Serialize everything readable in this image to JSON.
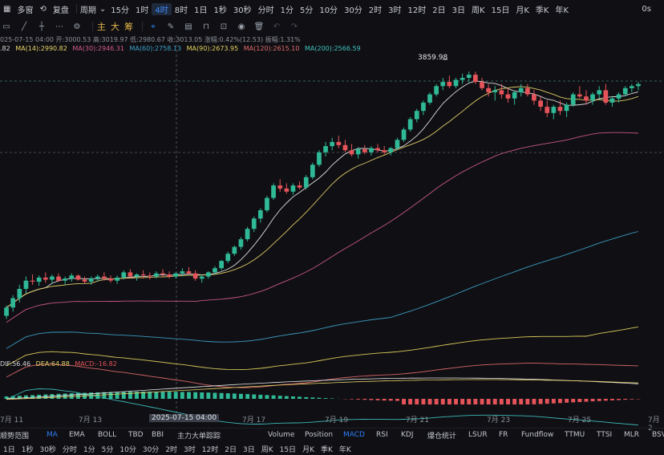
{
  "topbar": {
    "items": [
      "多窗",
      "复盘",
      "周期",
      "15分",
      "1时",
      "4时",
      "8时",
      "1日",
      "1秒",
      "30秒",
      "分时",
      "1分",
      "5分",
      "10分",
      "30分",
      "2时",
      "3时",
      "12时",
      "2日",
      "3日",
      "周K",
      "15日",
      "月K",
      "季K",
      "年K"
    ],
    "active": "4时",
    "right": "0s"
  },
  "toolbar": {
    "cn_buttons": [
      "主",
      "大",
      "筹"
    ]
  },
  "info": {
    "line1": "025-07-15 04:00  开:3000.53  高:3019.97  低:2980.67  收:3013.05  涨幅:0.42%(12.53)  振幅:1.31%",
    "ma": [
      {
        "text": ".82",
        "color": "#d8d8d8"
      },
      {
        "text": "MA(14):2990.82",
        "color": "#e8d36a"
      },
      {
        "text": "MA(30):2946.31",
        "color": "#d05a8a"
      },
      {
        "text": "MA(60):2758.13",
        "color": "#3da0c8"
      },
      {
        "text": "MA(90):2673.95",
        "color": "#e3d25d"
      },
      {
        "text": "MA(120):2615.10",
        "color": "#e06a6a"
      },
      {
        "text": "MA(200):2566.59",
        "color": "#3fc1c0"
      }
    ]
  },
  "macd": {
    "dif": "DIF:56.46",
    "dea": "DEA:64.88",
    "macd": "MACD:-16.82"
  },
  "high_label": "3859.98",
  "xaxis": {
    "labels": [
      "7月 11",
      "7月 13",
      "2025-07-15 04:00",
      "7月 17",
      "7月 19",
      "7月 21",
      "7月 23",
      "7月 25",
      "7月 2"
    ]
  },
  "indicators": {
    "items": [
      "顺势范围",
      "MA",
      "EMA",
      "BOLL",
      "TBD",
      "BBI",
      "主力大单踪踪",
      "Volume",
      "Position",
      "MACD",
      "RSI",
      "KDJ",
      "爆仓统计",
      "LSUR",
      "FR",
      "Fundflow",
      "TTMU",
      "TTSI",
      "MLR",
      "BSV"
    ],
    "active": [
      "MA",
      "MACD"
    ]
  },
  "bottombar": {
    "items": [
      "1日",
      "1秒",
      "30秒",
      "分时",
      "1分",
      "5分",
      "10分",
      "30分",
      "2时",
      "3时",
      "12时",
      "2日",
      "3日",
      "周K",
      "15日",
      "月K",
      "季K",
      "年K"
    ]
  },
  "colors": {
    "up": "#2fb996",
    "down": "#e5545a",
    "bg": "#101014"
  },
  "chart_data": {
    "type": "candlestick",
    "note_unit": "ETH price",
    "candles": [
      [
        2680,
        2730,
        2665,
        2720
      ],
      [
        2720,
        2780,
        2700,
        2765
      ],
      [
        2765,
        2830,
        2745,
        2810
      ],
      [
        2810,
        2870,
        2790,
        2850
      ],
      [
        2850,
        2880,
        2830,
        2845
      ],
      [
        2845,
        2875,
        2825,
        2865
      ],
      [
        2865,
        2890,
        2840,
        2855
      ],
      [
        2855,
        2880,
        2835,
        2870
      ],
      [
        2870,
        2885,
        2845,
        2850
      ],
      [
        2850,
        2870,
        2830,
        2860
      ],
      [
        2860,
        2885,
        2845,
        2875
      ],
      [
        2875,
        2880,
        2850,
        2855
      ],
      [
        2855,
        2870,
        2835,
        2845
      ],
      [
        2845,
        2870,
        2830,
        2860
      ],
      [
        2860,
        2880,
        2845,
        2870
      ],
      [
        2870,
        2890,
        2850,
        2860
      ],
      [
        2860,
        2875,
        2840,
        2850
      ],
      [
        2850,
        2875,
        2835,
        2865
      ],
      [
        2865,
        2900,
        2855,
        2890
      ],
      [
        2890,
        2905,
        2860,
        2870
      ],
      [
        2870,
        2885,
        2850,
        2880
      ],
      [
        2880,
        2900,
        2860,
        2875
      ],
      [
        2875,
        2890,
        2855,
        2870
      ],
      [
        2870,
        2895,
        2860,
        2885
      ],
      [
        2885,
        2905,
        2870,
        2880
      ],
      [
        2880,
        2895,
        2860,
        2870
      ],
      [
        2870,
        2890,
        2860,
        2885
      ],
      [
        2885,
        2910,
        2870,
        2895
      ],
      [
        2895,
        2915,
        2880,
        2885
      ],
      [
        2885,
        2900,
        2850,
        2860
      ],
      [
        2860,
        2880,
        2840,
        2870
      ],
      [
        2870,
        2895,
        2860,
        2890
      ],
      [
        2890,
        2920,
        2880,
        2910
      ],
      [
        2910,
        2950,
        2900,
        2945
      ],
      [
        2945,
        2990,
        2935,
        2980
      ],
      [
        2980,
        3020,
        2970,
        3013
      ],
      [
        3013,
        3060,
        3000,
        3050
      ],
      [
        3050,
        3110,
        3040,
        3100
      ],
      [
        3100,
        3160,
        3085,
        3150
      ],
      [
        3150,
        3200,
        3130,
        3190
      ],
      [
        3190,
        3260,
        3180,
        3250
      ],
      [
        3250,
        3320,
        3240,
        3310
      ],
      [
        3310,
        3340,
        3280,
        3295
      ],
      [
        3295,
        3320,
        3270,
        3280
      ],
      [
        3280,
        3320,
        3265,
        3310
      ],
      [
        3310,
        3330,
        3290,
        3300
      ],
      [
        3300,
        3360,
        3290,
        3350
      ],
      [
        3350,
        3420,
        3340,
        3410
      ],
      [
        3410,
        3480,
        3400,
        3470
      ],
      [
        3470,
        3520,
        3450,
        3500
      ],
      [
        3500,
        3540,
        3480,
        3520
      ],
      [
        3520,
        3550,
        3490,
        3505
      ],
      [
        3505,
        3530,
        3470,
        3480
      ],
      [
        3480,
        3510,
        3450,
        3460
      ],
      [
        3460,
        3495,
        3440,
        3485
      ],
      [
        3485,
        3505,
        3460,
        3470
      ],
      [
        3470,
        3500,
        3455,
        3490
      ],
      [
        3490,
        3510,
        3470,
        3480
      ],
      [
        3480,
        3500,
        3460,
        3470
      ],
      [
        3470,
        3495,
        3455,
        3490
      ],
      [
        3490,
        3540,
        3480,
        3530
      ],
      [
        3530,
        3590,
        3520,
        3580
      ],
      [
        3580,
        3640,
        3570,
        3630
      ],
      [
        3630,
        3680,
        3615,
        3670
      ],
      [
        3670,
        3720,
        3650,
        3710
      ],
      [
        3710,
        3760,
        3700,
        3750
      ],
      [
        3750,
        3800,
        3740,
        3790
      ],
      [
        3790,
        3830,
        3770,
        3810
      ],
      [
        3810,
        3840,
        3780,
        3790
      ],
      [
        3790,
        3830,
        3780,
        3820
      ],
      [
        3820,
        3850,
        3800,
        3830
      ],
      [
        3830,
        3860,
        3810,
        3845
      ],
      [
        3845,
        3859.98,
        3800,
        3810
      ],
      [
        3810,
        3830,
        3770,
        3780
      ],
      [
        3780,
        3800,
        3740,
        3760
      ],
      [
        3760,
        3790,
        3720,
        3770
      ],
      [
        3770,
        3800,
        3730,
        3750
      ],
      [
        3750,
        3780,
        3710,
        3730
      ],
      [
        3730,
        3770,
        3700,
        3760
      ],
      [
        3760,
        3800,
        3740,
        3780
      ],
      [
        3780,
        3800,
        3740,
        3750
      ],
      [
        3750,
        3770,
        3700,
        3720
      ],
      [
        3720,
        3740,
        3670,
        3690
      ],
      [
        3690,
        3720,
        3640,
        3660
      ],
      [
        3660,
        3700,
        3630,
        3690
      ],
      [
        3690,
        3720,
        3650,
        3670
      ],
      [
        3670,
        3710,
        3640,
        3700
      ],
      [
        3700,
        3760,
        3690,
        3750
      ],
      [
        3750,
        3790,
        3730,
        3740
      ],
      [
        3740,
        3770,
        3700,
        3720
      ],
      [
        3720,
        3760,
        3700,
        3750
      ],
      [
        3750,
        3790,
        3730,
        3770
      ],
      [
        3770,
        3800,
        3700,
        3710
      ],
      [
        3710,
        3740,
        3690,
        3730
      ],
      [
        3730,
        3760,
        3710,
        3750
      ],
      [
        3750,
        3790,
        3740,
        3780
      ],
      [
        3780,
        3800,
        3760,
        3790
      ],
      [
        3790,
        3810,
        3770,
        3800
      ]
    ],
    "ylim": [
      2500,
      3950
    ]
  }
}
